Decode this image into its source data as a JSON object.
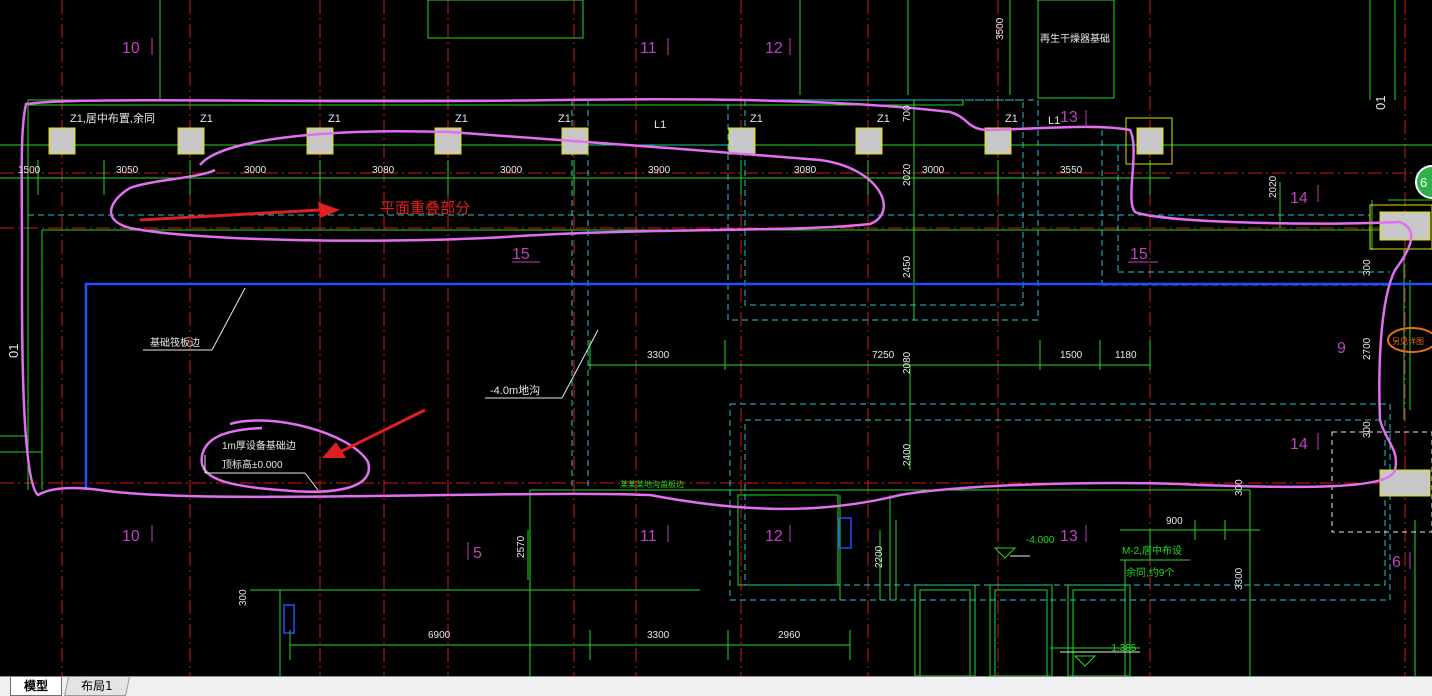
{
  "drawing": {
    "axis_labels_magenta": [
      {
        "text": "10",
        "id": "axis-10-top"
      },
      {
        "text": "11",
        "id": "axis-11-top"
      },
      {
        "text": "12",
        "id": "axis-12-top"
      },
      {
        "text": "13",
        "id": "axis-13-top"
      },
      {
        "text": "14",
        "id": "axis-14-a"
      },
      {
        "text": "15",
        "id": "axis-15-a"
      },
      {
        "text": "15",
        "id": "axis-15-b"
      },
      {
        "text": "9",
        "id": "axis-9"
      },
      {
        "text": "14",
        "id": "axis-14-b"
      },
      {
        "text": "10",
        "id": "axis-10-bottom"
      },
      {
        "text": "5",
        "id": "axis-5"
      },
      {
        "text": "11",
        "id": "axis-11-bottom"
      },
      {
        "text": "12",
        "id": "axis-12-bottom"
      },
      {
        "text": "13",
        "id": "axis-13-bottom"
      },
      {
        "text": "6",
        "id": "axis-6"
      }
    ],
    "column_labels": [
      "Z1,居中布置,余同",
      "Z1",
      "Z1",
      "Z1",
      "Z1",
      "Z1",
      "Z1",
      "Z1",
      "L1"
    ],
    "beam_label": "L1",
    "dimensions_top": [
      "1500",
      "3050",
      "3000",
      "3080",
      "3000",
      "3900",
      "3080",
      "3000",
      "3550"
    ],
    "dimensions_vertical": [
      "700",
      "2020",
      "2450",
      "2080",
      "2400",
      "2570",
      "2200",
      "2020",
      "300",
      "2700",
      "300",
      "300",
      "3300",
      "300",
      "3500"
    ],
    "dimensions_mid": [
      "3300",
      "7250",
      "1500",
      "1180"
    ],
    "dimensions_bottom": [
      "6900",
      "3300",
      "2960",
      "900"
    ],
    "texts_white": {
      "foundation_edge": "基础筏板边",
      "pit": "-4.0m地沟",
      "equip_base": "1m厚设备基础边",
      "top_elev": "顶标高±0.000",
      "regen_dryer": "再生干燥器基础",
      "side_01_left": "01",
      "side_01_right": "01"
    },
    "texts_green": {
      "elev_neg4": "-4.000",
      "door_m2": "M-2,居中布设",
      "door_m2_sub": "余同,约9个",
      "elev_neg1385": "-1.385",
      "centerline_note": "某某某地沟盖板边"
    },
    "annotation_red": "平面重叠部分",
    "orange_note": "另见详图",
    "edge_circle_text": "6"
  },
  "tabs": {
    "model": "模型",
    "layout1": "布局1"
  },
  "colors": {
    "background": "#000000",
    "axis_red": "#d01818",
    "dim_green": "#22d822",
    "cyan_dash": "#1ec8d8",
    "magenta_text": "#c040c0",
    "blue_line": "#2050ff",
    "pink_markup": "#e070f0",
    "red_annotation": "#e02020",
    "column_fill": "#c8c8c8",
    "yellow": "#e0e000"
  }
}
